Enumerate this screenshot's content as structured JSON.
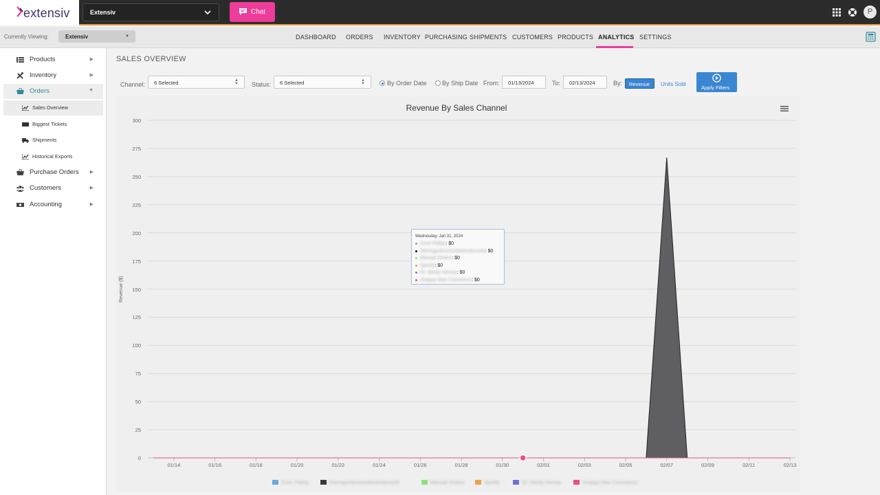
{
  "brand": {
    "logo_text": "extensiv",
    "accent_pink": "#ee3c9a",
    "accent_blue": "#3a86d2",
    "accent_orange": "#e39a3d"
  },
  "topbar": {
    "account_select": "Extensiv",
    "chat_label": "Chat",
    "avatar_initial": "P",
    "icons": [
      "apps-grid-icon",
      "help-lifebuoy-icon",
      "user-avatar"
    ]
  },
  "navbar": {
    "currently_viewing_label": "Currently Viewing:",
    "currently_viewing_value": "Extensiv",
    "links": [
      "DASHBOARD",
      "ORDERS",
      "INVENTORY",
      "PURCHASING",
      "SHIPMENTS",
      "CUSTOMERS",
      "PRODUCTS",
      "ANALYTICS",
      "SETTINGS"
    ],
    "active": "ANALYTICS"
  },
  "sidebar": {
    "items": [
      {
        "label": "Products",
        "icon": "list-icon"
      },
      {
        "label": "Inventory",
        "icon": "tools-icon"
      },
      {
        "label": "Orders",
        "icon": "basket-icon"
      },
      {
        "label": "Purchase Orders",
        "icon": "basket-icon"
      },
      {
        "label": "Customers",
        "icon": "users-icon"
      },
      {
        "label": "Accounting",
        "icon": "money-icon"
      }
    ],
    "orders_sub": [
      {
        "label": "Sales Overview",
        "icon": "chart-icon"
      },
      {
        "label": "Biggest Tickets",
        "icon": "ticket-icon"
      },
      {
        "label": "Shipments",
        "icon": "truck-icon"
      },
      {
        "label": "Historical Exports",
        "icon": "chart-icon"
      }
    ]
  },
  "page": {
    "title": "SALES OVERVIEW"
  },
  "filters": {
    "channel_label": "Channel:",
    "channel_value": "6 Selected",
    "status_label": "Status:",
    "status_value": "6 Selected",
    "by_order_date": "By Order Date",
    "by_ship_date": "By Ship Date",
    "from_label": "From:",
    "from_value": "01/13/2024",
    "to_label": "To:",
    "to_value": "02/13/2024",
    "by_label": "By:",
    "revenue_label": "Revenue",
    "units_label": "Units Sold",
    "apply_label": "Apply Filters"
  },
  "tooltip": {
    "header": "Wednesday, Jan 31, 2024",
    "rows": [
      {
        "name": "Zone Paltay",
        "value": "$0",
        "color": "#6aa6e0"
      },
      {
        "name": "Warmgartenzoonbeekstenvold",
        "value": "$0",
        "color": "#111111"
      },
      {
        "name": "Manual Orders",
        "value": "$0",
        "color": "#8ee07a"
      },
      {
        "name": "Spotify",
        "value": "$0",
        "color": "#f0a050"
      },
      {
        "name": "Dr. Mindy Harvey",
        "value": "$0",
        "color": "#6f6fe0"
      },
      {
        "name": "Snappy Max Commerce",
        "value": "$0",
        "color": "#ef4e7a"
      }
    ]
  },
  "chart_data": {
    "type": "area",
    "title": "Revenue By Sales Channel",
    "ylabel": "Revenue ($)",
    "xlabel": "",
    "ylim": [
      0,
      300
    ],
    "yticks": [
      0,
      25,
      50,
      75,
      100,
      125,
      150,
      175,
      200,
      225,
      250,
      275,
      300
    ],
    "x_tick_labels": [
      "01/14",
      "01/16",
      "01/18",
      "01/20",
      "01/22",
      "01/24",
      "01/26",
      "01/28",
      "01/30",
      "02/01",
      "02/03",
      "02/05",
      "02/07",
      "02/09",
      "02/11",
      "02/13"
    ],
    "x": [
      "01/13",
      "01/14",
      "01/15",
      "01/16",
      "01/17",
      "01/18",
      "01/19",
      "01/20",
      "01/21",
      "01/22",
      "01/23",
      "01/24",
      "01/25",
      "01/26",
      "01/27",
      "01/28",
      "01/29",
      "01/30",
      "01/31",
      "02/01",
      "02/02",
      "02/03",
      "02/04",
      "02/05",
      "02/06",
      "02/07",
      "02/08",
      "02/09",
      "02/10",
      "02/11",
      "02/12",
      "02/13"
    ],
    "series": [
      {
        "name": "Zone Paltay",
        "color": "#6aa6e0",
        "values": [
          0,
          0,
          0,
          0,
          0,
          0,
          0,
          0,
          0,
          0,
          0,
          0,
          0,
          0,
          0,
          0,
          0,
          0,
          0,
          0,
          0,
          0,
          0,
          0,
          0,
          0,
          0,
          0,
          0,
          0,
          0,
          0
        ]
      },
      {
        "name": "Warmgartenzoonbeekstenvold",
        "color": "#3a3a3a",
        "values": [
          0,
          0,
          0,
          0,
          0,
          0,
          0,
          0,
          0,
          0,
          0,
          0,
          0,
          0,
          0,
          0,
          0,
          0,
          0,
          0,
          0,
          0,
          0,
          0,
          0,
          267,
          0,
          0,
          0,
          0,
          0,
          0
        ]
      },
      {
        "name": "Manual Orders",
        "color": "#8ee07a",
        "values": [
          0,
          0,
          0,
          0,
          0,
          0,
          0,
          0,
          0,
          0,
          0,
          0,
          0,
          0,
          0,
          0,
          0,
          0,
          0,
          0,
          0,
          0,
          0,
          0,
          0,
          0,
          0,
          0,
          0,
          0,
          0,
          0
        ]
      },
      {
        "name": "Spotify",
        "color": "#f0a050",
        "values": [
          0,
          0,
          0,
          0,
          0,
          0,
          0,
          0,
          0,
          0,
          0,
          0,
          0,
          0,
          0,
          0,
          0,
          0,
          0,
          0,
          0,
          0,
          0,
          0,
          0,
          0,
          0,
          0,
          0,
          0,
          0,
          0
        ]
      },
      {
        "name": "Dr. Mindy Harvey",
        "color": "#6f6fe0",
        "values": [
          0,
          0,
          0,
          0,
          0,
          0,
          0,
          0,
          0,
          0,
          0,
          0,
          0,
          0,
          0,
          0,
          0,
          0,
          0,
          0,
          0,
          0,
          0,
          0,
          0,
          0,
          0,
          0,
          0,
          0,
          0,
          0
        ]
      },
      {
        "name": "Snappy Max Commerce",
        "color": "#ef4e7a",
        "values": [
          0,
          0,
          0,
          0,
          0,
          0,
          0,
          0,
          0,
          0,
          0,
          0,
          0,
          0,
          0,
          0,
          0,
          0,
          0,
          0,
          0,
          0,
          0,
          0,
          0,
          0,
          0,
          0,
          0,
          0,
          0,
          0
        ]
      }
    ],
    "highlight_x": "01/31",
    "grid": true,
    "legend_position": "bottom"
  }
}
